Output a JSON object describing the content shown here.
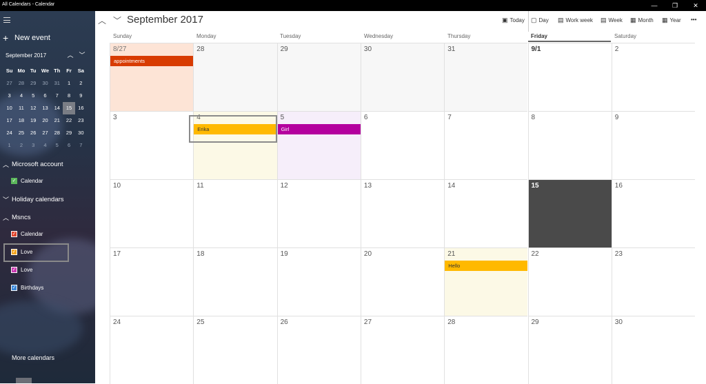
{
  "window": {
    "title": "All Calendars - Calendar",
    "minimize": "—",
    "maximize": "❐",
    "close": "✕"
  },
  "sidebar": {
    "new_event": "New event",
    "mini_calendar": {
      "title": "September 2017",
      "weekdays": [
        "Su",
        "Mo",
        "Tu",
        "We",
        "Th",
        "Fr",
        "Sa"
      ],
      "weeks": [
        [
          "27",
          "28",
          "29",
          "30",
          "31",
          "1",
          "2"
        ],
        [
          "3",
          "4",
          "5",
          "6",
          "7",
          "8",
          "9"
        ],
        [
          "10",
          "11",
          "12",
          "13",
          "14",
          "15",
          "16"
        ],
        [
          "17",
          "18",
          "19",
          "20",
          "21",
          "22",
          "23"
        ],
        [
          "24",
          "25",
          "26",
          "27",
          "28",
          "29",
          "30"
        ],
        [
          "1",
          "2",
          "3",
          "4",
          "5",
          "6",
          "7"
        ]
      ],
      "selected": "15"
    },
    "sections": [
      {
        "label": "Microsoft account",
        "calendars": [
          {
            "label": "Calendar",
            "color": "#5cb85c"
          }
        ]
      },
      {
        "label": "Holiday calendars",
        "calendars": []
      },
      {
        "label": "Msncs",
        "calendars": [
          {
            "label": "Calendar",
            "color": "#e0462e"
          },
          {
            "label": "Love",
            "color": "#f5a623"
          },
          {
            "label": "Love",
            "color": "#c837b0"
          },
          {
            "label": "Birthdays",
            "color": "#3a86d8"
          }
        ]
      }
    ],
    "more_calendars": "More calendars"
  },
  "header": {
    "month_title": "September 2017",
    "views": {
      "today": "Today",
      "day": "Day",
      "work_week": "Work week",
      "week": "Week",
      "month": "Month",
      "year": "Year",
      "more": "•••"
    }
  },
  "weekdays": [
    "Sunday",
    "Monday",
    "Tuesday",
    "Wednesday",
    "Thursday",
    "Friday",
    "Saturday"
  ],
  "weeks": [
    [
      "8/27",
      "28",
      "29",
      "30",
      "31",
      "9/1",
      "2"
    ],
    [
      "3",
      "4",
      "5",
      "6",
      "7",
      "8",
      "9"
    ],
    [
      "10",
      "11",
      "12",
      "13",
      "14",
      "15",
      "16"
    ],
    [
      "17",
      "18",
      "19",
      "20",
      "21",
      "22",
      "23"
    ],
    [
      "24",
      "25",
      "26",
      "27",
      "28",
      "29",
      "30"
    ]
  ],
  "events": [
    {
      "label": "appointments",
      "color": "#d83b01"
    },
    {
      "label": "Erika",
      "color": "#ffb900"
    },
    {
      "label": "Girl",
      "color": "#b4009e"
    },
    {
      "label": "Hello",
      "color": "#ffb900"
    }
  ],
  "colors": {
    "today_bg": "#4a4a4a",
    "weekend_sel": "#fde4d6",
    "erika_bg": "#fcf9e6",
    "girl_bg": "#f6eefa",
    "hello_bg": "#fcf9e6"
  }
}
